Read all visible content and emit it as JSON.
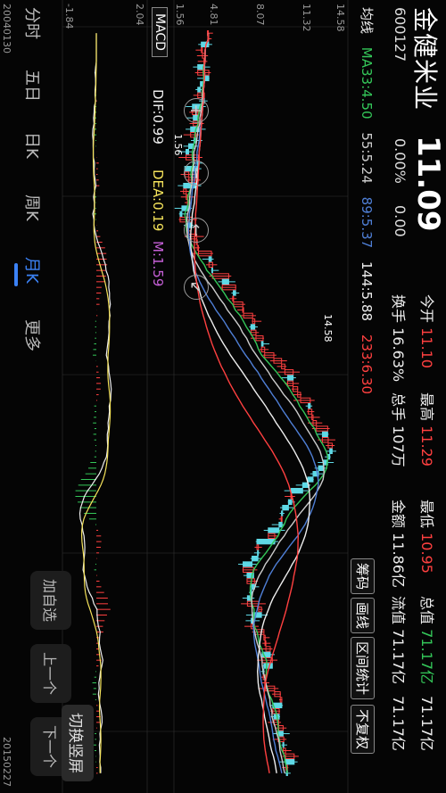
{
  "stock": {
    "name": "金健米业",
    "code": "600127",
    "price": "11.09",
    "change_pct": "0.00%",
    "change_abs": "0.00"
  },
  "quote": {
    "open_label": "今开",
    "open": "11.10",
    "high_label": "最高",
    "high": "11.29",
    "low_label": "最低",
    "low": "10.95",
    "total_mv_label": "总值",
    "total_mv": "71.17亿",
    "turnover_label": "换手",
    "turnover": "16.63%",
    "total_hands_label": "总手",
    "total_hands": "107万",
    "amount_label": "金额",
    "amount": "11.86亿",
    "float_mv_label": "流值",
    "float_mv": "71.17亿"
  },
  "ma_legend": {
    "label": "均线",
    "ma33": "MA33:4.50",
    "ma55": "55:5.24",
    "ma89": "89:5.37",
    "ma144": "144:5.88",
    "ma233": "233:6.30",
    "colors": {
      "ma33": "#34c759",
      "ma55": "#cccccc",
      "ma89": "#4f7fd6",
      "ma144": "#eeeeee",
      "ma233": "#ff4040"
    }
  },
  "right_buttons": [
    "筹码",
    "画线",
    "区间统计",
    "不复权"
  ],
  "switch_label": "切换竖屏",
  "nav": {
    "add": "加自选",
    "prev": "上一个",
    "next": "下一个"
  },
  "tabs": [
    "分时",
    "五日",
    "日K",
    "周K",
    "月K",
    "更多"
  ],
  "active_tab": "月K",
  "macd": {
    "button": "MACD",
    "dif": "DIF:0.99",
    "dea": "DEA:0.19",
    "m": "M:1.59"
  },
  "axis": {
    "price_top": "14.58",
    "price_mid1": "11.32",
    "price_mid2": "8.07",
    "price_mid3": "4.81",
    "price_bottom": "1.56",
    "macd_top": "2.04",
    "macd_bottom": "-1.84",
    "date_start": "20040130",
    "date_end": "20150227",
    "high_marker": "14.58",
    "low_marker": "1.56"
  },
  "zoom_icons": [
    "zoom-in-icon",
    "zoom-out-icon",
    "scroll-left-icon",
    "collapse-icon"
  ]
}
